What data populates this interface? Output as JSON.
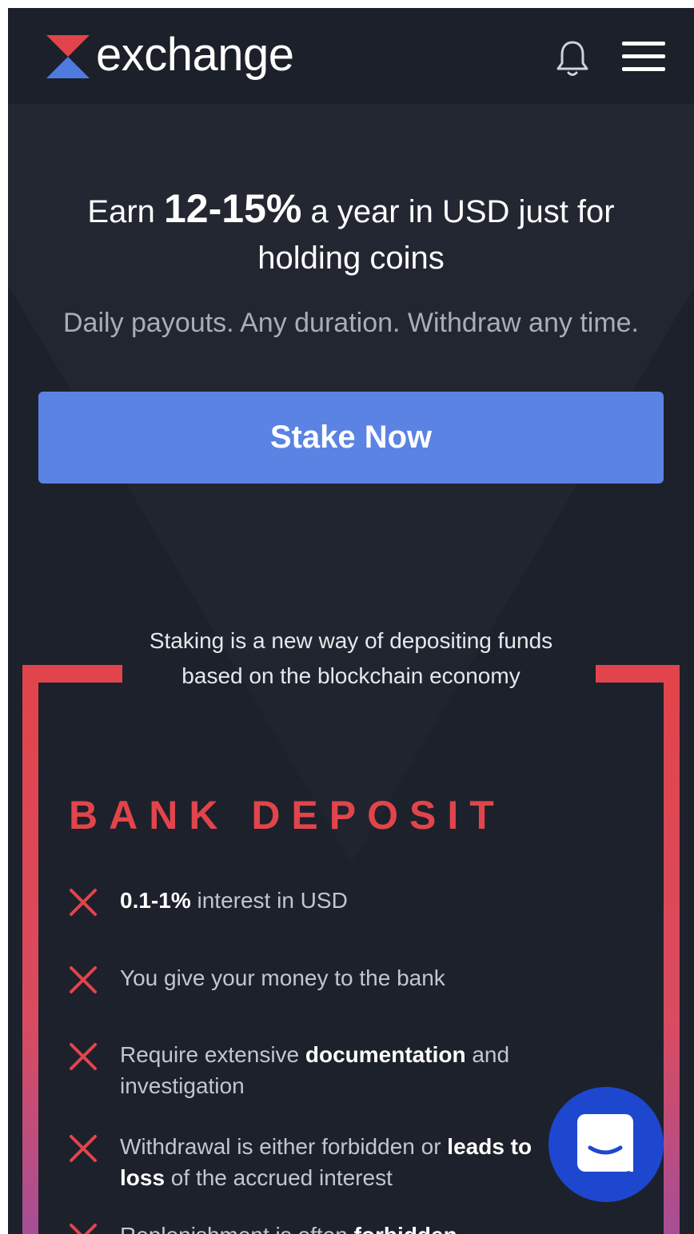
{
  "header": {
    "brand": "exchange",
    "logo_colors": {
      "top": "#e2444b",
      "bottom": "#4f7be0"
    }
  },
  "hero": {
    "headline_prefix": "Earn ",
    "headline_rate": "12-15%",
    "headline_suffix": " a year in USD just for holding coins",
    "subline": "Daily payouts. Any duration. Withdraw any time.",
    "cta_label": "Stake Now"
  },
  "intro": "Staking is a new way of depositing funds based on the blockchain economy",
  "bank_deposit": {
    "title": "BANK DEPOSIT",
    "items": [
      {
        "bold": "0.1-1%",
        "rest": " interest in USD"
      },
      {
        "text": "You give your money to the bank"
      },
      {
        "pre": "Require extensive ",
        "bold": "documentation",
        "post": " and investigation"
      },
      {
        "pre": "Withdrawal is either forbidden or ",
        "bold": "leads to loss",
        "post": " of the accrued interest"
      },
      {
        "pre": "Replenishment is often ",
        "bold": "forbidden"
      }
    ]
  },
  "colors": {
    "background": "#1d212b",
    "accent_red": "#e2444b",
    "button_blue": "#5b83e3",
    "chat_blue": "#1e47d0"
  },
  "icons": [
    "logo-icon",
    "bell-icon",
    "hamburger-menu-icon",
    "x-mark-icon",
    "chat-icon"
  ]
}
